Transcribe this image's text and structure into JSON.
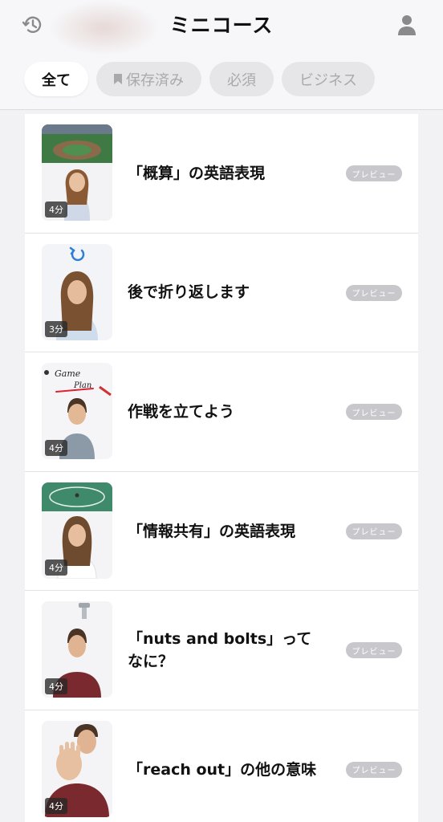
{
  "header": {
    "title": "ミニコース",
    "history_icon": "history-icon",
    "profile_icon": "person-icon"
  },
  "tabs": [
    {
      "label": "全て",
      "active": true
    },
    {
      "label": "保存済み",
      "active": false,
      "icon": "bookmark-icon"
    },
    {
      "label": "必須",
      "active": false
    },
    {
      "label": "ビジネス",
      "active": false
    }
  ],
  "courses": [
    {
      "title": "「概算」の英語表現",
      "duration": "4分",
      "preview": "プレビュー"
    },
    {
      "title": "後で折り返します",
      "duration": "3分",
      "preview": "プレビュー"
    },
    {
      "title": "作戦を立てよう",
      "duration": "4分",
      "preview": "プレビュー"
    },
    {
      "title": "「情報共有」の英語表現",
      "duration": "4分",
      "preview": "プレビュー"
    },
    {
      "title": "「nuts and bolts」ってなに？",
      "duration": "4分",
      "preview": "プレビュー"
    },
    {
      "title": "「reach out」の他の意味",
      "duration": "4分",
      "preview": "プレビュー"
    }
  ],
  "thumb_texts": {
    "game": "Game",
    "plan": "Plan"
  },
  "colors": {
    "field_green": "#4a8a4e",
    "text": "#111111",
    "preview_badge": "#c8c8cc"
  }
}
